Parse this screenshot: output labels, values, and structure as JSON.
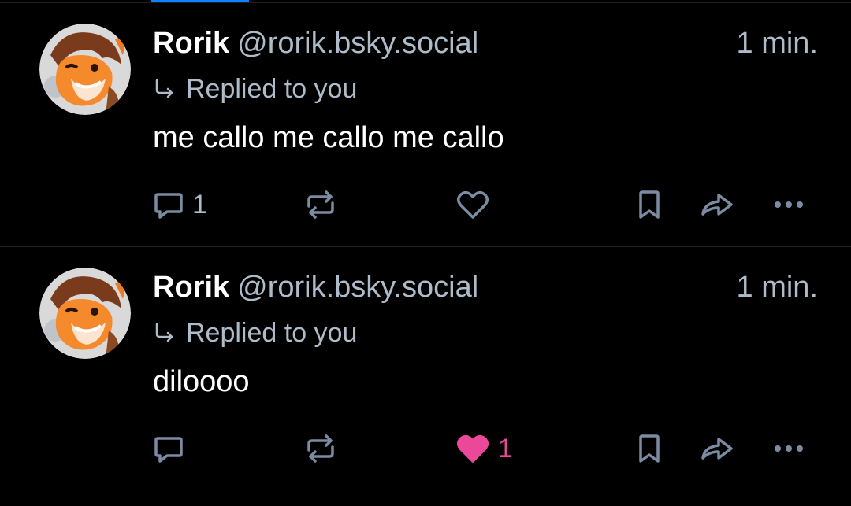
{
  "posts": [
    {
      "display_name": "Rorik",
      "handle": "@rorik.bsky.social",
      "timestamp": "1 min.",
      "reply_text": "Replied to you",
      "text": "me callo me callo me callo",
      "reply_count": "1",
      "like_count": "",
      "liked": false
    },
    {
      "display_name": "Rorik",
      "handle": "@rorik.bsky.social",
      "timestamp": "1 min.",
      "reply_text": "Replied to you",
      "text": "diloooo",
      "reply_count": "",
      "like_count": "1",
      "liked": true
    }
  ],
  "colors": {
    "background": "#000000",
    "muted_text": "#aebbc9",
    "icon": "#7b8ba1",
    "like_active": "#ec4899",
    "accent": "#1083fe"
  },
  "icons": [
    "reply-arrow-icon",
    "comment-icon",
    "repost-icon",
    "heart-icon",
    "bookmark-icon",
    "share-icon",
    "more-icon"
  ]
}
